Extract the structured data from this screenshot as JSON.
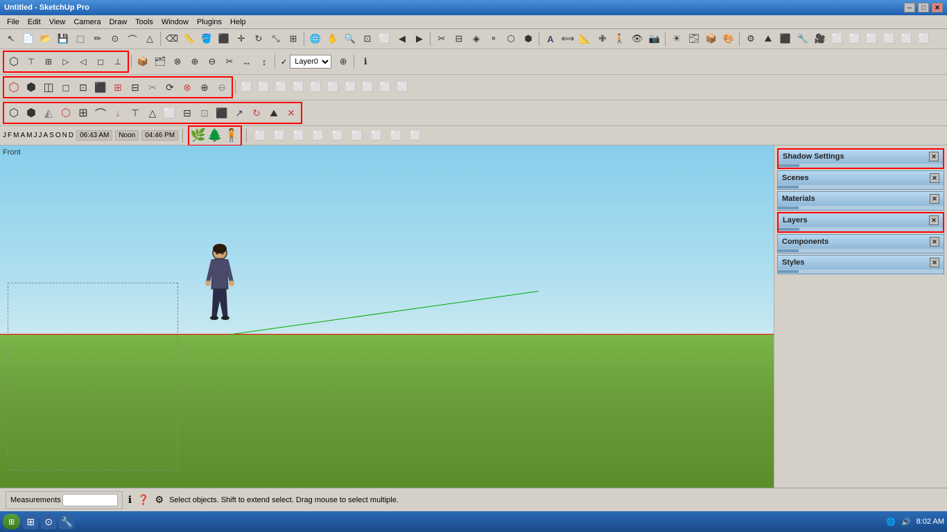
{
  "app": {
    "title": "Untitled - SketchUp Pro",
    "titlebar_controls": [
      "minimize",
      "maximize",
      "close"
    ]
  },
  "menubar": {
    "items": [
      "File",
      "Edit",
      "View",
      "Camera",
      "Draw",
      "Tools",
      "Window",
      "Plugins",
      "Help"
    ]
  },
  "toolbar1": {
    "buttons": [
      "arrow",
      "rectangle",
      "pushpull",
      "move",
      "rotate",
      "scale",
      "tape",
      "protractor",
      "paint",
      "eraser",
      "orbit",
      "pan",
      "zoom",
      "zoomfit",
      "undo",
      "redo",
      "cut",
      "copy",
      "paste"
    ]
  },
  "toolbar2": {
    "layer_checkbox_label": "✓",
    "layer_name": "Layer0",
    "buttons": []
  },
  "toolbar3_highlight": {
    "buttons": [
      "3d_cube",
      "front_view",
      "side_view"
    ]
  },
  "toolbar4_highlight": {
    "buttons": [
      "iso",
      "top",
      "front",
      "right",
      "back",
      "left",
      "bottom"
    ]
  },
  "timeline": {
    "months": [
      "J",
      "F",
      "M",
      "A",
      "M",
      "J",
      "J",
      "A",
      "S",
      "O",
      "N",
      "D"
    ],
    "time1": "06:43 AM",
    "noon": "Noon",
    "time2": "04:46 PM"
  },
  "right_panel": {
    "sections": [
      {
        "id": "shadow-settings",
        "label": "Shadow Settings",
        "highlight": true
      },
      {
        "id": "scenes",
        "label": "Scenes"
      },
      {
        "id": "materials",
        "label": "Materials"
      },
      {
        "id": "layers",
        "label": "Layers",
        "highlight": true
      },
      {
        "id": "components",
        "label": "Components"
      },
      {
        "id": "styles",
        "label": "Styles"
      }
    ]
  },
  "viewport": {
    "label": "Front"
  },
  "statusbar": {
    "measurements_tab": "Measurements",
    "status_message": "Select objects. Shift to extend select. Drag mouse to select multiple."
  },
  "taskbar": {
    "time": "8:02 AM",
    "apps": [
      "windows",
      "chrome",
      "taskapp"
    ]
  }
}
